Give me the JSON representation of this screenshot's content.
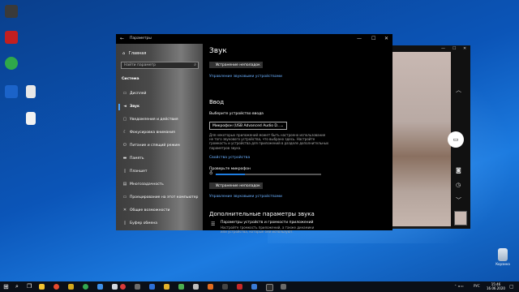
{
  "desktop": {
    "icons": [
      {
        "label": "",
        "color": "#3a3a3a"
      },
      {
        "label": "",
        "color": "#c21f1f"
      },
      {
        "label": "",
        "color": "#2fa84a"
      },
      {
        "label": "",
        "color": "#1b63c9"
      },
      {
        "label": "",
        "color": "#e8e8e8"
      },
      {
        "label": "",
        "color": "#f2f2f2"
      }
    ],
    "recycle_bin_label": "Корзина"
  },
  "settings": {
    "window_title": "Параметры",
    "controls": {
      "minimize": "—",
      "maximize": "☐",
      "close": "✕"
    },
    "nav": {
      "home": "Главная",
      "search_placeholder": "Найти параметр",
      "section": "Система",
      "items": [
        {
          "icon": "display-icon",
          "glyph": "▭",
          "label": "Дисплей",
          "selected": false
        },
        {
          "icon": "sound-icon",
          "glyph": "🔈",
          "label": "Звук",
          "selected": true
        },
        {
          "icon": "notifications-icon",
          "glyph": "▢",
          "label": "Уведомления и действия",
          "selected": false
        },
        {
          "icon": "focus-assist-icon",
          "glyph": "☾",
          "label": "Фокусировка внимания",
          "selected": false
        },
        {
          "icon": "power-icon",
          "glyph": "⏻",
          "label": "Питание и спящий режим",
          "selected": false
        },
        {
          "icon": "storage-icon",
          "glyph": "▬",
          "label": "Память",
          "selected": false
        },
        {
          "icon": "tablet-icon",
          "glyph": "▯",
          "label": "Планшет",
          "selected": false
        },
        {
          "icon": "multitasking-icon",
          "glyph": "▤",
          "label": "Многозадачность",
          "selected": false
        },
        {
          "icon": "projecting-icon",
          "glyph": "▭",
          "label": "Проецирование на этот компьютер",
          "selected": false
        },
        {
          "icon": "shared-experiences-icon",
          "glyph": "✕",
          "label": "Общие возможности",
          "selected": false
        },
        {
          "icon": "clipboard-icon",
          "glyph": "▯",
          "label": "Буфер обмена",
          "selected": false
        }
      ]
    },
    "content": {
      "title": "Звук",
      "troubleshoot_label": "Устранение неполадок",
      "manage_devices_link": "Управление звуковыми устройствами",
      "input_heading": "Ввод",
      "choose_input_label": "Выберите устройство ввода",
      "input_device_value": "Микрофон (USB Advanced Audio D...",
      "help_text": "Для некоторых приложений может быть настроено использование не того звукового устройства, что выбрано здесь. Настройте громкость и устройства для приложений в разделе дополнительных параметров звука.",
      "device_properties_link": "Свойства устройства",
      "test_mic_label": "Проверьте микрофон",
      "mic_level": 0.28,
      "troubleshoot_label_2": "Устранение неполадок",
      "manage_devices_link_2": "Управление звуковыми устройствами",
      "advanced_heading": "Дополнительные параметры звука",
      "app_volume_title": "Параметры устройств и громкости приложений",
      "app_volume_desc": "Настройте громкость приложений, а также динамики или устройства, которые они используют."
    }
  },
  "camera": {
    "rail_icons": [
      "chevron-up-icon",
      "video-icon",
      "camera-icon",
      "timer-icon",
      "chevron-down-icon"
    ]
  },
  "taskbar": {
    "tray_lang": "РУС",
    "time": "15:46",
    "date": "16.06.2020"
  }
}
